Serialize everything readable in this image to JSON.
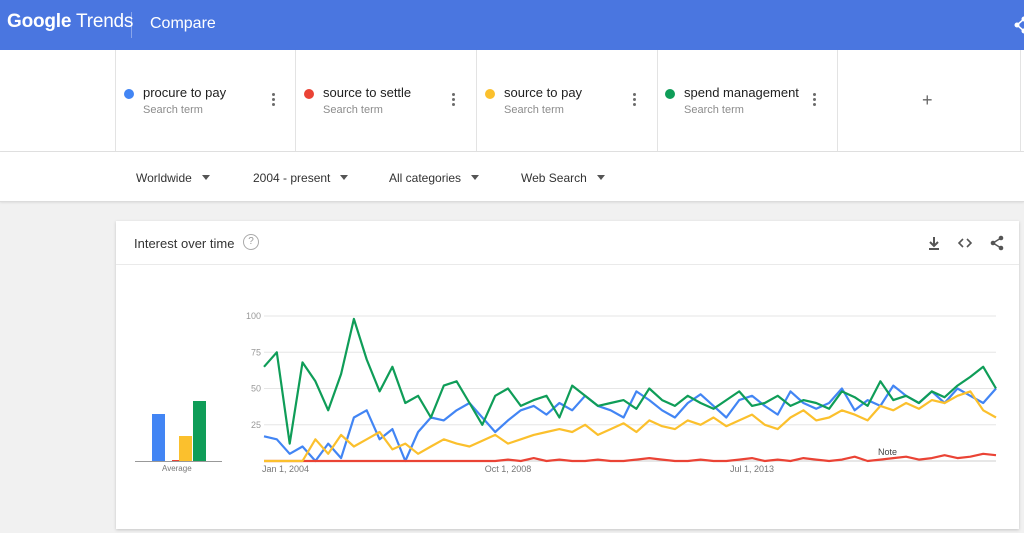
{
  "header": {
    "logo_google": "Google",
    "logo_trends": "Trends",
    "title": "Compare"
  },
  "terms": [
    {
      "label": "procure to pay",
      "sub": "Search term",
      "color": "#4285f4"
    },
    {
      "label": "source to settle",
      "sub": "Search term",
      "color": "#ea4335"
    },
    {
      "label": "source to pay",
      "sub": "Search term",
      "color": "#fbc02d"
    },
    {
      "label": "spend management",
      "sub": "Search term",
      "color": "#0f9d58"
    }
  ],
  "add_term_symbol": "+",
  "filters": {
    "region": "Worldwide",
    "time": "2004 - present",
    "category": "All categories",
    "property": "Web Search"
  },
  "card": {
    "title": "Interest over time",
    "help": "?",
    "average_label": "Average",
    "note": "Note"
  },
  "icons": {
    "download": "download-icon",
    "embed": "embed-icon",
    "share": "share-icon",
    "help": "help-circle-icon",
    "more": "more-vert-icon",
    "add": "plus-icon"
  },
  "chart_data": {
    "type": "line",
    "title": "Interest over time",
    "ylim": [
      0,
      100
    ],
    "yticks": [
      25,
      50,
      75,
      100
    ],
    "xticks": [
      "Jan 1, 2004",
      "Oct 1, 2008",
      "Jul 1, 2013"
    ],
    "x": [
      "2004-01",
      "2004-04",
      "2004-07",
      "2004-10",
      "2005-01",
      "2005-04",
      "2005-07",
      "2005-10",
      "2006-01",
      "2006-04",
      "2006-07",
      "2006-10",
      "2007-01",
      "2007-04",
      "2007-07",
      "2007-10",
      "2008-01",
      "2008-04",
      "2008-07",
      "2008-10",
      "2009-01",
      "2009-04",
      "2009-07",
      "2009-10",
      "2010-01",
      "2010-04",
      "2010-07",
      "2010-10",
      "2011-01",
      "2011-04",
      "2011-07",
      "2011-10",
      "2012-01",
      "2012-04",
      "2012-07",
      "2012-10",
      "2013-01",
      "2013-04",
      "2013-07",
      "2013-10",
      "2014-01",
      "2014-04",
      "2014-07",
      "2014-10",
      "2015-01",
      "2015-04",
      "2015-07",
      "2015-10",
      "2016-01",
      "2016-04",
      "2016-07",
      "2016-10",
      "2017-01",
      "2017-04",
      "2017-07",
      "2017-10",
      "2018-01",
      "2018-04"
    ],
    "series": [
      {
        "name": "procure to pay",
        "color": "#4285f4",
        "values": [
          17,
          15,
          5,
          10,
          0,
          12,
          2,
          30,
          35,
          15,
          22,
          0,
          20,
          30,
          28,
          35,
          40,
          30,
          20,
          28,
          35,
          38,
          32,
          40,
          35,
          45,
          38,
          35,
          30,
          48,
          42,
          35,
          30,
          40,
          46,
          38,
          30,
          42,
          45,
          38,
          32,
          48,
          40,
          36,
          40,
          50,
          35,
          42,
          38,
          52,
          45,
          40,
          48,
          40,
          50,
          45,
          40,
          50
        ]
      },
      {
        "name": "source to settle",
        "color": "#ea4335",
        "values": [
          0,
          0,
          0,
          0,
          0,
          0,
          0,
          0,
          0,
          0,
          0,
          0,
          0,
          0,
          0,
          0,
          0,
          0,
          0,
          1,
          0,
          2,
          0,
          1,
          0,
          0,
          1,
          0,
          0,
          1,
          2,
          1,
          0,
          0,
          1,
          0,
          0,
          1,
          2,
          0,
          1,
          0,
          2,
          1,
          0,
          1,
          3,
          0,
          1,
          2,
          3,
          1,
          2,
          4,
          2,
          3,
          5,
          4
        ]
      },
      {
        "name": "source to pay",
        "color": "#fbc02d",
        "values": [
          0,
          0,
          0,
          0,
          15,
          5,
          18,
          10,
          15,
          20,
          8,
          12,
          5,
          10,
          15,
          12,
          10,
          14,
          18,
          12,
          15,
          18,
          20,
          22,
          20,
          25,
          18,
          22,
          26,
          20,
          28,
          24,
          22,
          28,
          25,
          30,
          24,
          28,
          32,
          25,
          22,
          30,
          35,
          28,
          30,
          35,
          32,
          28,
          38,
          35,
          40,
          36,
          42,
          40,
          45,
          48,
          35,
          30
        ]
      },
      {
        "name": "spend management",
        "color": "#0f9d58",
        "values": [
          65,
          75,
          12,
          68,
          55,
          35,
          60,
          98,
          70,
          48,
          65,
          40,
          45,
          30,
          52,
          55,
          40,
          25,
          45,
          50,
          38,
          42,
          45,
          30,
          52,
          45,
          38,
          40,
          42,
          36,
          50,
          42,
          38,
          45,
          40,
          36,
          42,
          48,
          38,
          40,
          45,
          38,
          42,
          40,
          36,
          48,
          44,
          38,
          55,
          42,
          45,
          40,
          48,
          44,
          52,
          58,
          65,
          50
        ]
      }
    ],
    "averages": [
      {
        "name": "procure to pay",
        "color": "#4285f4",
        "value": 32
      },
      {
        "name": "source to settle",
        "color": "#ea4335",
        "value": 1
      },
      {
        "name": "source to pay",
        "color": "#fbc02d",
        "value": 17
      },
      {
        "name": "spend management",
        "color": "#0f9d58",
        "value": 41
      }
    ],
    "grid": true,
    "legend": "top"
  }
}
